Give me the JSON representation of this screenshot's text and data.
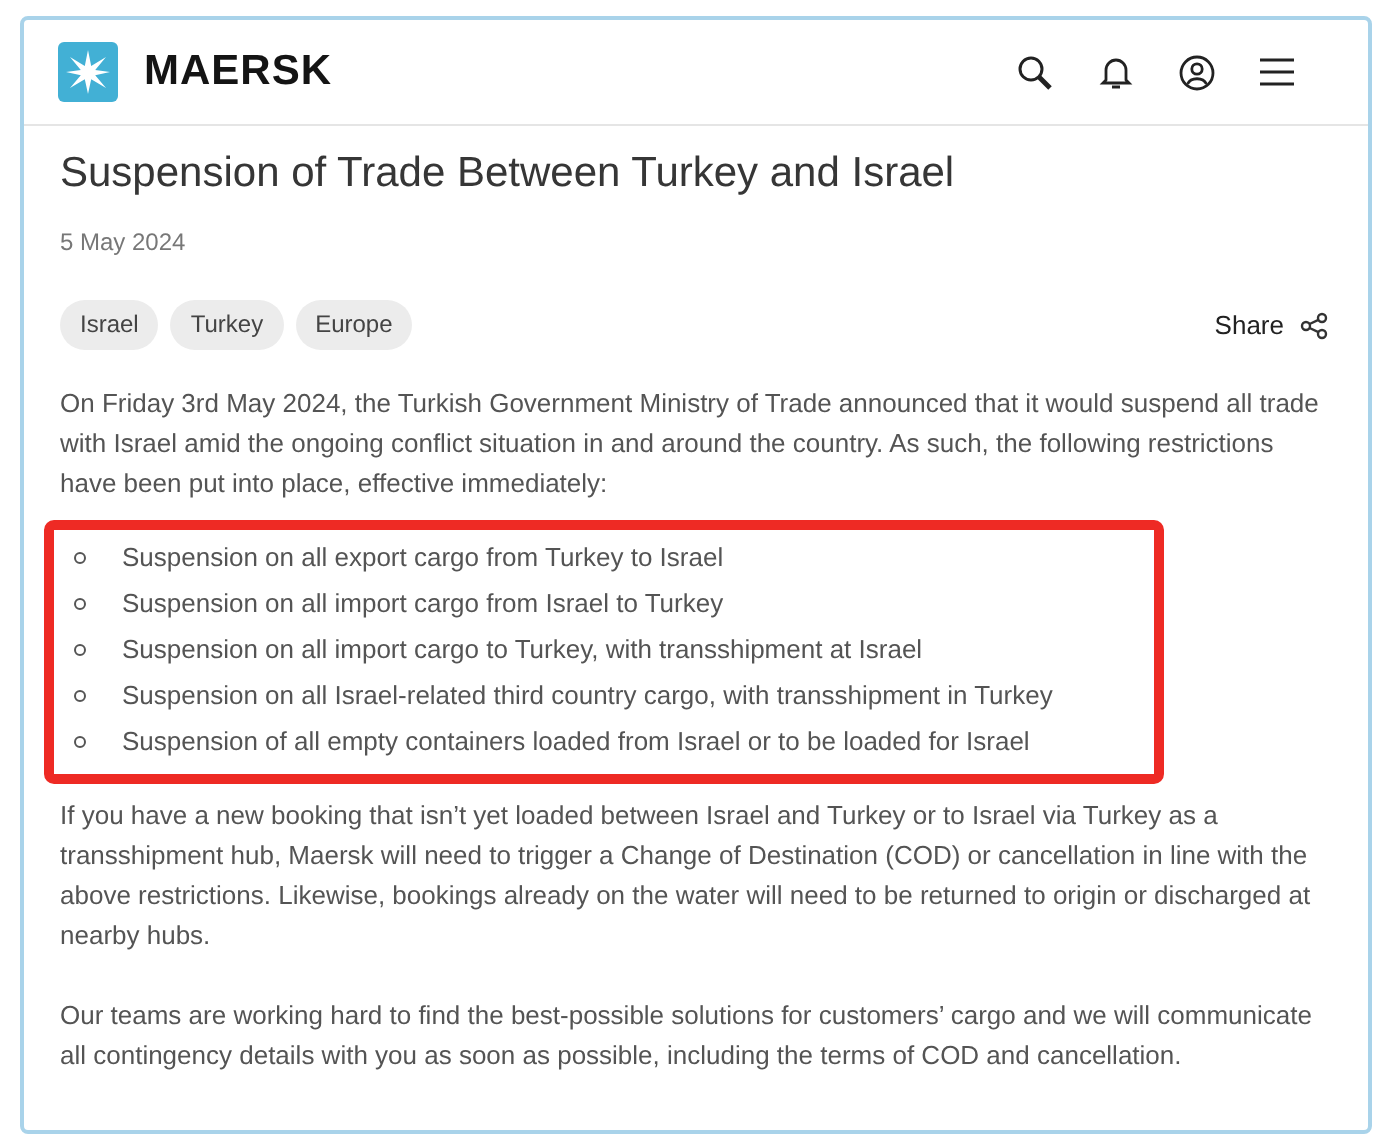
{
  "header": {
    "brand": "MAERSK"
  },
  "article": {
    "title": "Suspension of Trade Between Turkey and Israel",
    "date": "5 May 2024",
    "tags": [
      "Israel",
      "Turkey",
      "Europe"
    ],
    "share": "Share",
    "intro": "On Friday 3rd May 2024, the Turkish Government Ministry of Trade announced that it would suspend all trade with Israel amid the ongoing conflict situation in and around the country. As such, the following restrictions have been put into place, effective immediately:",
    "restrictions": [
      "Suspension on all export cargo from Turkey to Israel",
      "Suspension on all import cargo from Israel to Turkey",
      "Suspension on all import cargo to Turkey, with transshipment at Israel",
      "Suspension on all Israel-related third country cargo, with transshipment in Turkey",
      "Suspension of all empty containers loaded from Israel or to be loaded for Israel"
    ],
    "paragraphs": [
      "If you have a new booking that isn’t yet loaded between Israel and Turkey or to Israel via Turkey as a transshipment hub, Maersk will need to trigger a Change of Destination (COD) or cancellation in line with the above restrictions. Likewise, bookings already on the water will need to be returned to origin or discharged at nearby hubs.",
      "Our teams are working hard to find the best-possible solutions for customers’ cargo and we will communicate all contingency details with you as soon as possible, including the terms of COD and cancellation."
    ]
  }
}
